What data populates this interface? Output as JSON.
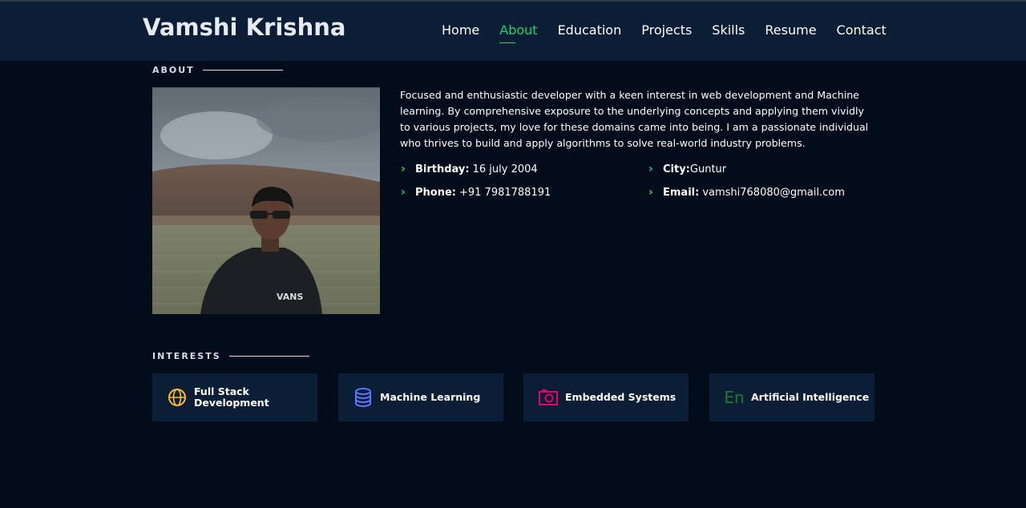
{
  "header": {
    "logo": "Vamshi Krishna",
    "nav": [
      {
        "label": "Home",
        "active": false
      },
      {
        "label": "About",
        "active": true
      },
      {
        "label": "Education",
        "active": false
      },
      {
        "label": "Projects",
        "active": false
      },
      {
        "label": "Skills",
        "active": false
      },
      {
        "label": "Resume",
        "active": false
      },
      {
        "label": "Contact",
        "active": false
      }
    ]
  },
  "about": {
    "title": "ABOUT",
    "description": "Focused and enthusiastic developer with a keen interest in web development and Machine learning. By comprehensive exposure to the underlying concepts and applying them vividly to various projects, my love for these domains came into being. I am a passionate individual who thrives to build and apply algorithms to solve real-world industry problems.",
    "details": {
      "birthday": {
        "label": "Birthday:",
        "value": "16 july 2004"
      },
      "phone": {
        "label": "Phone:",
        "value": "+91 7981788191"
      },
      "city": {
        "label": "City:",
        "value": "Guntur"
      },
      "email": {
        "label": "Email:",
        "value": "vamshi768080@gmail.com"
      }
    }
  },
  "interests": {
    "title": "INTERESTS",
    "items": [
      {
        "label": "Full Stack Development",
        "icon": "globe-icon",
        "color": "#ffbb2c"
      },
      {
        "label": "Machine Learning",
        "icon": "database-icon",
        "color": "#5578ff"
      },
      {
        "label": "Embedded Systems",
        "icon": "camera-icon",
        "color": "#e80368"
      },
      {
        "label": "Artificial Intelligence",
        "icon": "language-icon",
        "color": "#1c7c2c"
      }
    ]
  },
  "colors": {
    "accent": "#18d26e",
    "background": "#020c1b",
    "header_bg": "#0c1e36",
    "card_bg": "#0c1e36"
  }
}
